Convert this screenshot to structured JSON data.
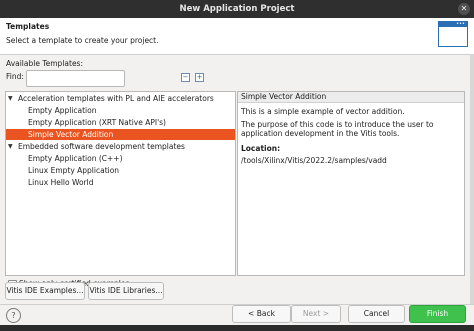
{
  "window": {
    "title": "New Application Project"
  },
  "header": {
    "title": "Templates",
    "subtitle": "Select a template to create your project."
  },
  "available_label": "Available Templates:",
  "find_label": "Find:",
  "find_value": "",
  "tree": [
    {
      "label": "Acceleration templates with PL and AIE accelerators",
      "level": 0,
      "expanded": true
    },
    {
      "label": "Empty Application",
      "level": 1
    },
    {
      "label": "Empty Application (XRT Native API's)",
      "level": 1
    },
    {
      "label": "Simple Vector Addition",
      "level": 1,
      "selected": true
    },
    {
      "label": "Embedded software development templates",
      "level": 0,
      "expanded": true
    },
    {
      "label": "Empty Application (C++)",
      "level": 1
    },
    {
      "label": "Linux Empty Application",
      "level": 1
    },
    {
      "label": "Linux Hello World",
      "level": 1
    }
  ],
  "detail": {
    "title": "Simple Vector Addition",
    "line1": "This is a simple example of vector addition.",
    "line2": "The purpose of this code is to introduce the user to application development in the Vitis tools.",
    "location_label": "Location:",
    "location_value": "/tools/Xilinx/Vitis/2022.2/samples/vadd"
  },
  "checkbox_label": "Show only certified examples",
  "buttons": {
    "examples": "Vitis IDE Examples...",
    "libraries": "Vitis IDE Libraries...",
    "back": "< Back",
    "next": "Next >",
    "cancel": "Cancel",
    "finish": "Finish"
  },
  "icons": {
    "close": "close-icon",
    "help": "help-icon",
    "collapse_all": "collapse-all-icon",
    "expand_all": "expand-all-icon"
  },
  "colors": {
    "selection": "#e95420",
    "finish": "#3ec14d"
  }
}
